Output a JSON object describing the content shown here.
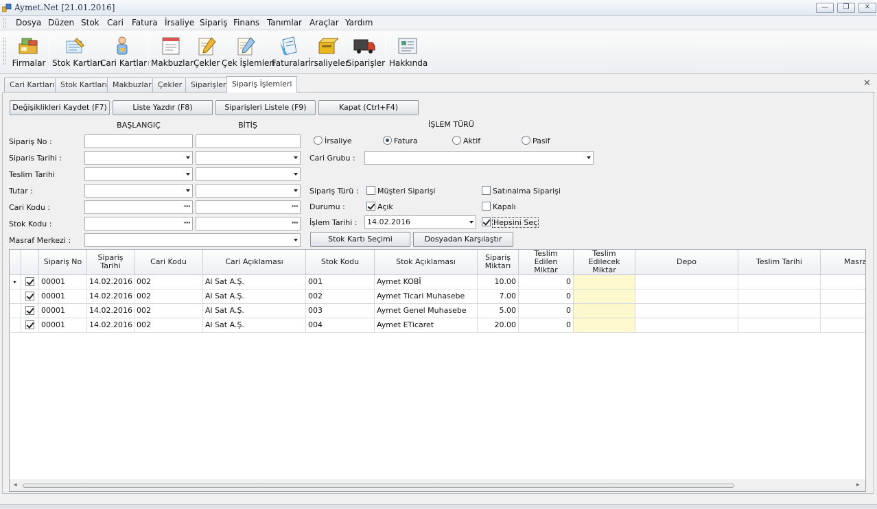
{
  "window": {
    "title": "Aymet.Net [21.01.2016]",
    "minimize": "—",
    "restore": "❐",
    "close": "✕"
  },
  "menu": [
    "Dosya",
    "Düzen",
    "Stok",
    "Cari",
    "Fatura",
    "İrsaliye",
    "Sipariş",
    "Finans",
    "Tanımlar",
    "Araçlar",
    "Yardım"
  ],
  "toolbar": [
    "Firmalar",
    "Stok Kartları",
    "Cari Kartları",
    "Makbuzlar",
    "Çekler",
    "Çek İşlemleri",
    "Faturalar",
    "İrsaliyeler",
    "Siparişler",
    "Hakkında"
  ],
  "tabs": [
    "Cari Kartları",
    "Stok Kartları",
    "Makbuzlar",
    "Çekler",
    "Siparişler",
    "Sipariş İşlemleri"
  ],
  "active_tab": "Sipariş İşlemleri",
  "tab_close": "✕",
  "actions": {
    "save": "Değişiklikleri Kaydet (F7)",
    "print": "Liste Yazdır (F8)",
    "list": "Siparişleri Listele (F9)",
    "close": "Kapat (Ctrl+F4)"
  },
  "headers": {
    "start": "BAŞLANGIÇ",
    "end": "BİTİŞ",
    "op_type": "İŞLEM TÜRÜ"
  },
  "filters": {
    "order_no": "Sipariş No :",
    "order_date": "Siparis Tarihi :",
    "delivery_date": "Teslim Tarihi",
    "amount": "Tutar  :",
    "customer_code": "Cari Kodu :",
    "stock_code": "Stok Kodu :",
    "cost_center": "Masraf Merkezi :"
  },
  "op_type": {
    "selected": "Fatura",
    "options": [
      "İrsaliye",
      "Fatura",
      "Aktif",
      "Pasif"
    ]
  },
  "customer_group": {
    "label": "Cari Grubu :",
    "value": ""
  },
  "order_type": {
    "label": "Sipariş Türü :",
    "customer_order": "Müşteri Siparişi",
    "purchase_order": "Satınalma Siparişi",
    "customer_order_checked": false,
    "purchase_order_checked": false
  },
  "status": {
    "label": "Durumu :",
    "open": "Açık",
    "closed": "Kapalı",
    "open_checked": true,
    "closed_checked": false
  },
  "op_date": {
    "label": "İşlem Tarihi :",
    "value": "14.02.2016"
  },
  "select_all": {
    "label": "Hepsini Seç",
    "checked": true
  },
  "stock_select_button": "Stok Kartı Seçimi",
  "compare_file_button": "Dosyadan Karşılaştır",
  "ellipsis": "···",
  "grid": {
    "columns": [
      "Sipariş No",
      "Sipariş Tarihi",
      "Cari Kodu",
      "Cari Açıklaması",
      "Stok Kodu",
      "Stok Açıklaması",
      "Sipariş Miktarı",
      "Teslim Edilen Miktar",
      "Teslim Edilecek Miktar",
      "Depo",
      "Teslim Tarihi",
      "Masraf"
    ],
    "rows": [
      {
        "checked": true,
        "cells": [
          "00001",
          "14.02.2016",
          "002",
          "Al Sat A.Ş.",
          "001",
          "Aymet KOBİ",
          "10.00",
          "0",
          "",
          "",
          "",
          ""
        ]
      },
      {
        "checked": true,
        "cells": [
          "00001",
          "14.02.2016",
          "002",
          "Al Sat A.Ş.",
          "002",
          "Aymet Ticari Muhasebe",
          "7.00",
          "0",
          "",
          "",
          "",
          ""
        ]
      },
      {
        "checked": true,
        "cells": [
          "00001",
          "14.02.2016",
          "002",
          "Al Sat A.Ş.",
          "003",
          "Aymet Genel Muhasebe",
          "5.00",
          "0",
          "",
          "",
          "",
          ""
        ]
      },
      {
        "checked": true,
        "cells": [
          "00001",
          "14.02.2016",
          "002",
          "Al Sat A.Ş.",
          "004",
          "Aymet ETicaret",
          "20.00",
          "0",
          "",
          "",
          "",
          ""
        ]
      }
    ],
    "highlight_color": "#fdf8cd"
  }
}
